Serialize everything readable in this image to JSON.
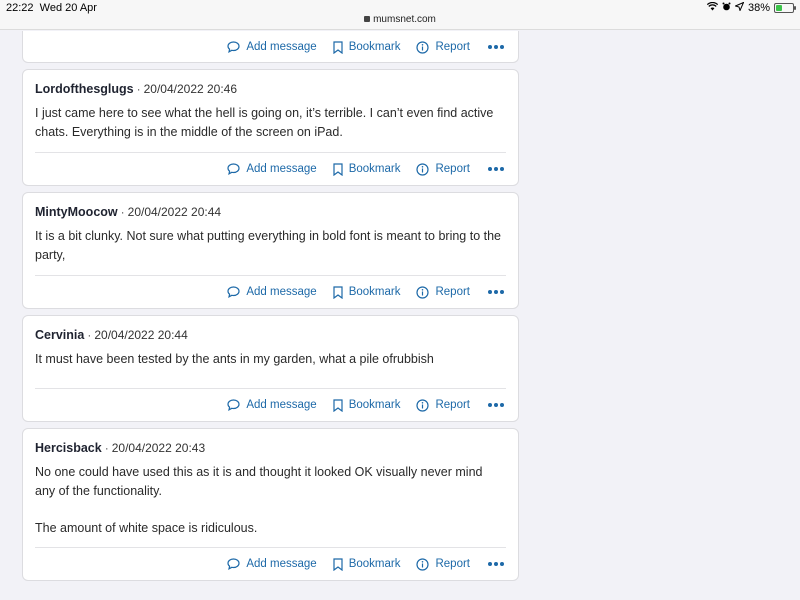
{
  "status_bar": {
    "time": "22:22",
    "date": "Wed 20 Apr",
    "url": "mumsnet.com",
    "battery": "38%",
    "battery_level": 0.38
  },
  "actions": {
    "add_message": "Add message",
    "bookmark": "Bookmark",
    "report": "Report"
  },
  "posts": [
    {
      "author": "Lordofthesglugs",
      "date": "20/04/2022 20:46",
      "paragraphs": [
        "I just came here to see what the hell is going on, it’s terrible. I can’t even find active chats. Everything is in the middle of the screen on iPad."
      ]
    },
    {
      "author": "MintyMoocow",
      "date": "20/04/2022 20:44",
      "paragraphs": [
        "It is a bit clunky. Not sure what putting everything in bold font is meant to bring to the party,"
      ]
    },
    {
      "author": "Cervinia",
      "date": "20/04/2022 20:44",
      "paragraphs": [
        "It must have been tested by the ants in my garden, what a pile ofrubbish"
      ]
    },
    {
      "author": "Hercisback",
      "date": "20/04/2022 20:43",
      "paragraphs": [
        "No one could have used this as it is and thought it looked OK visually never mind any of the functionality.",
        "The amount of white space is ridiculous."
      ]
    }
  ]
}
